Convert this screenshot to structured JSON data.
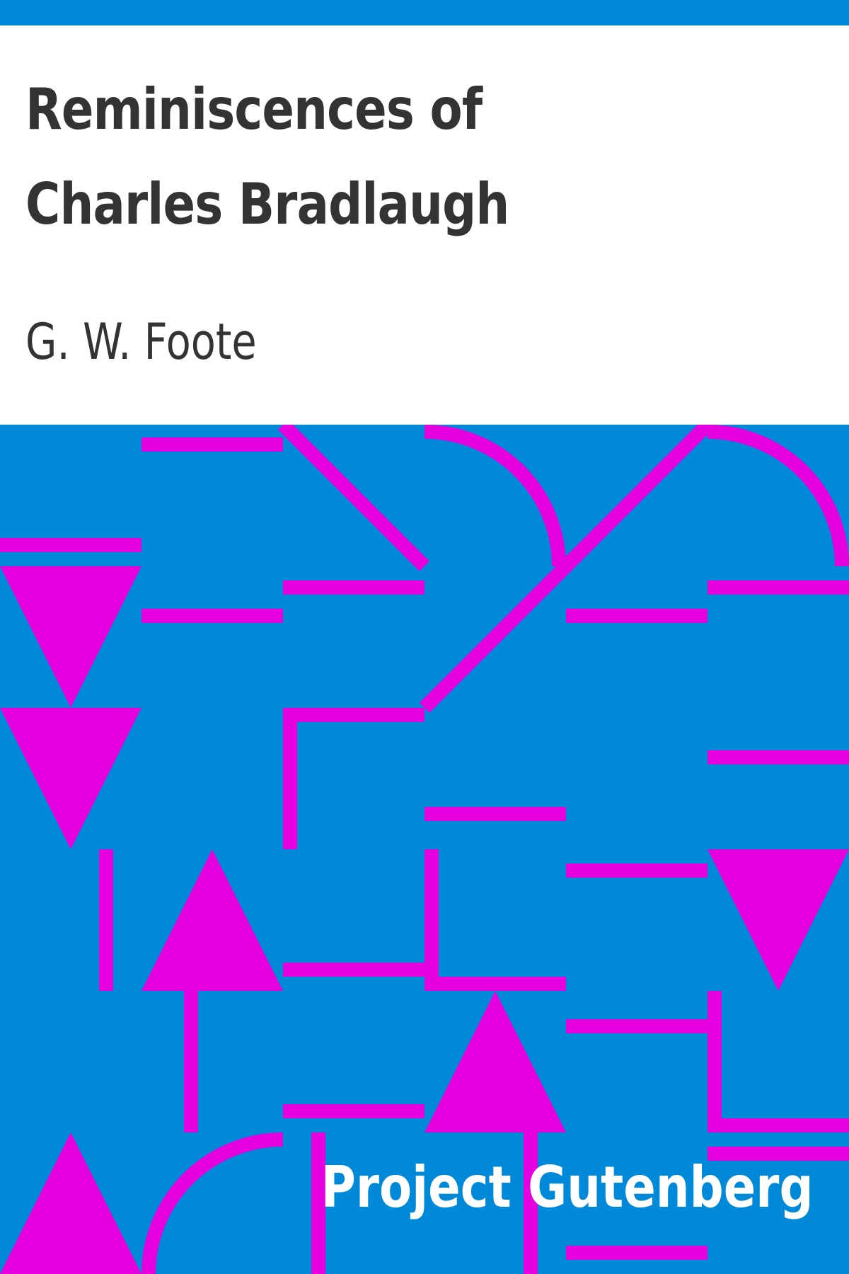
{
  "book": {
    "title": "Reminiscences of Charles Bradlaugh",
    "author": "G. W. Foote",
    "publisher": "Project Gutenberg"
  },
  "colors": {
    "background_blue": "#0088d9",
    "pattern_magenta": "#e600e0",
    "text_dark": "#333333",
    "text_light": "#ffffff"
  },
  "pattern": {
    "icons": [
      "triangle-down-icon",
      "triangle-up-icon",
      "arc-icon",
      "line-segment-icon"
    ]
  }
}
